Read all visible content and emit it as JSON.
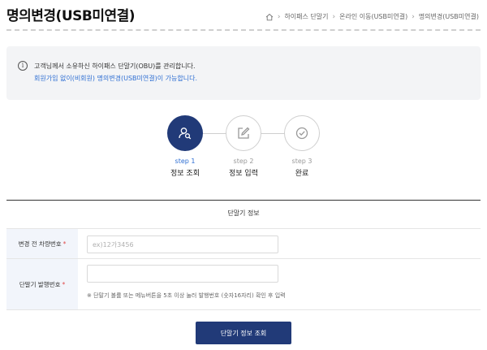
{
  "header": {
    "title": "명의변경(USB미연결)",
    "breadcrumb": [
      "하이패스 단말기",
      "온라인 이동(USB미연결)",
      "명의변경(USB미연결)"
    ]
  },
  "notice": {
    "line1": "고객님께서 소유하신 하이패스 단말기(OBU)를 관리합니다.",
    "line2": "회원가입 없이(비회원) 명의변경(USB미연결)이 가능합니다."
  },
  "steps": [
    {
      "num": "step 1",
      "label": "정보 조회",
      "icon": "user-search-icon",
      "active": true
    },
    {
      "num": "step 2",
      "label": "정보 입력",
      "icon": "edit-icon",
      "active": false
    },
    {
      "num": "step 3",
      "label": "완료",
      "icon": "check-circle-icon",
      "active": false
    }
  ],
  "form": {
    "section_title": "단말기 정보",
    "vehicle_label": "변경 전 차량번호",
    "vehicle_placeholder": "ex)12가3456",
    "vehicle_value": "",
    "device_label": "단말기 발행번호",
    "device_placeholder": "",
    "device_value": "",
    "device_hint": "※ 단말기 볼륨 또는 메뉴버튼을 5초 이상 눌러 발행번호 (숫자16자리) 확인 후 입력",
    "required_mark": "*"
  },
  "actions": {
    "submit_label": "단말기 정보 조회"
  },
  "colors": {
    "primary": "#213a78",
    "link": "#2f6fd3",
    "required": "#e04b4b"
  }
}
